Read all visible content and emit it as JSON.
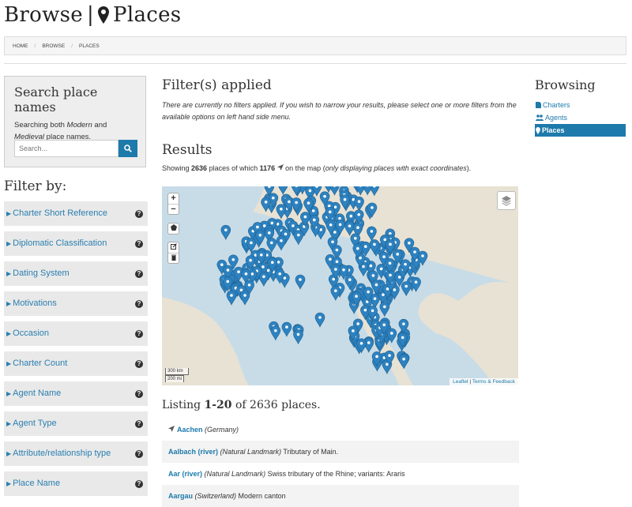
{
  "header": {
    "title_prefix": "Browse",
    "title_sep": "|",
    "title_main": "Places"
  },
  "breadcrumb": [
    "HOME",
    "BROWSE",
    "PLACES"
  ],
  "search": {
    "title": "Search place names",
    "desc_a": "Searching both ",
    "desc_modern": "Modern",
    "desc_b": " and ",
    "desc_medieval": "Medieval",
    "desc_c": " place names.",
    "placeholder": "Search..."
  },
  "filters": {
    "title": "Filter by:",
    "items": [
      "Charter Short Reference",
      "Diplomatic Classification",
      "Dating System",
      "Motivations",
      "Occasion",
      "Charter Count",
      "Agent Name",
      "Agent Type",
      "Attribute/relationship type",
      "Place Name"
    ]
  },
  "main": {
    "filters_title": "Filter(s) applied",
    "filters_note": "There are currently no filters applied. If you wish to narrow your results, please select one or more filters from the available options on left hand side menu.",
    "results_title": "Results",
    "showing_a": "Showing ",
    "showing_total": "2636",
    "showing_b": " places of which ",
    "showing_mapped": "1176",
    "showing_c": " on the map (",
    "showing_note": "only displaying places with exact coordinates",
    "showing_d": ")."
  },
  "map": {
    "zoom_in": "+",
    "zoom_out": "−",
    "scale_km": "300 km",
    "scale_mi": "200 mi",
    "attribution_leaflet": "Leaflet",
    "attribution_sep": " | ",
    "attribution_terms": "Terms & Feedback",
    "marker_color": "#2e82c0",
    "land_color": "#e8e2d4",
    "sea_color": "#c8dce7"
  },
  "listing": {
    "prefix": "Listing ",
    "range": "1-20",
    "mid": " of 2636 places."
  },
  "results": [
    {
      "name": "Aachen",
      "qualifier": "(Germany)",
      "desc": ""
    },
    {
      "name": "Aalbach (river)",
      "qualifier": "(Natural Landmark)",
      "desc": " Tributary of Main."
    },
    {
      "name": "Aar (river)",
      "qualifier": "(Natural Landmark)",
      "desc": " Swiss tributary of the Rhine; variants: Araris"
    },
    {
      "name": "Aargau",
      "qualifier": "(Switzerland)",
      "desc": " Modern canton"
    }
  ],
  "browsing": {
    "title": "Browsing",
    "items": [
      {
        "label": "Charters",
        "active": false
      },
      {
        "label": "Agents",
        "active": false
      },
      {
        "label": "Places",
        "active": true
      }
    ]
  }
}
